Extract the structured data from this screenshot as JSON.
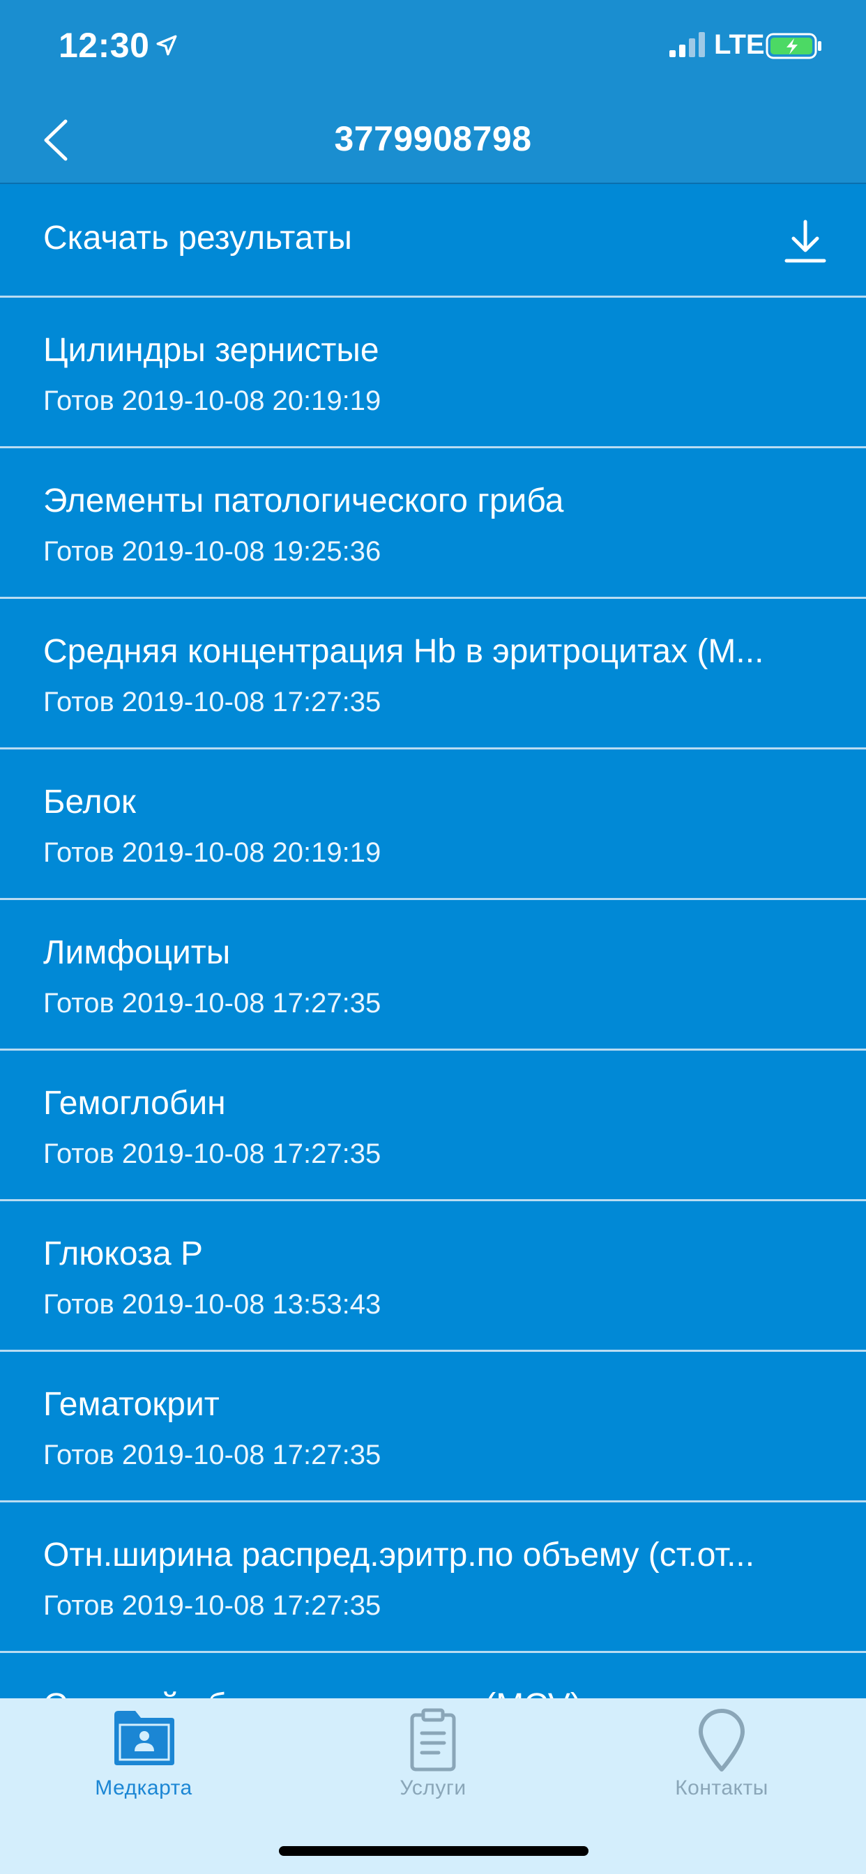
{
  "status_bar": {
    "time": "12:30",
    "network": "LTE",
    "icons": [
      "location-arrow-icon",
      "signal-bars-icon",
      "battery-charging-icon"
    ]
  },
  "nav": {
    "title": "3779908798",
    "back_icon": "chevron-left-icon"
  },
  "download": {
    "label": "Скачать результаты",
    "icon": "download-icon"
  },
  "results": [
    {
      "title": "Цилиндры зернистые",
      "status": "Готов 2019-10-08 20:19:19"
    },
    {
      "title": "Элементы патологического гриба",
      "status": "Готов 2019-10-08 19:25:36"
    },
    {
      "title": "Средняя концентрация Hb в эритроцитах (M...",
      "status": "Готов 2019-10-08 17:27:35"
    },
    {
      "title": "Белок",
      "status": "Готов 2019-10-08 20:19:19"
    },
    {
      "title": "Лимфоциты",
      "status": "Готов 2019-10-08 17:27:35"
    },
    {
      "title": "Гемоглобин",
      "status": "Готов 2019-10-08 17:27:35"
    },
    {
      "title": "Глюкоза Р",
      "status": "Готов 2019-10-08 13:53:43"
    },
    {
      "title": "Гематокрит",
      "status": "Готов 2019-10-08 17:27:35"
    },
    {
      "title": "Отн.ширина распред.эритр.по объему (ст.от...",
      "status": "Готов 2019-10-08 17:27:35"
    },
    {
      "title": "Средний объем эритроцита (MCV)",
      "status": ""
    }
  ],
  "tabs": [
    {
      "label": "Медкарта",
      "icon": "medical-folder-icon",
      "active": true
    },
    {
      "label": "Услуги",
      "icon": "clipboard-icon",
      "active": false
    },
    {
      "label": "Контакты",
      "icon": "map-pin-icon",
      "active": false
    }
  ],
  "colors": {
    "header": "#1a8ed0",
    "list_background": "#0189d6",
    "divider": "#b9dcf2",
    "tab_bar": "#d4eefc",
    "tab_active": "#1b86d4",
    "tab_inactive": "#8aa6b8"
  }
}
